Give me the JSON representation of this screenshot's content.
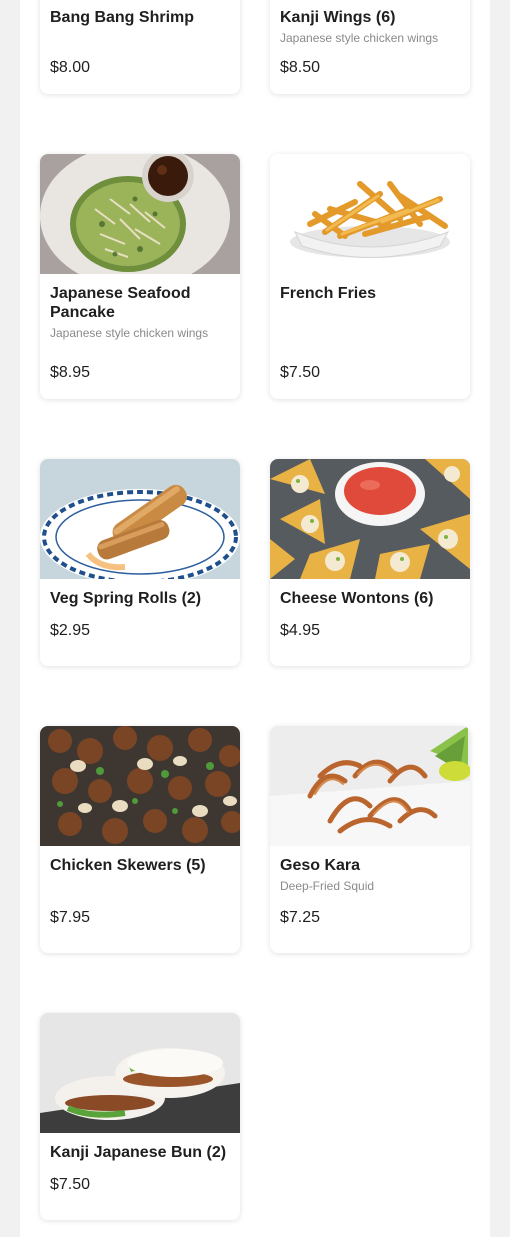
{
  "menu": {
    "items": [
      {
        "name": "Bang Bang Shrimp",
        "description": "",
        "price": "$8.00"
      },
      {
        "name": "Kanji Wings (6)",
        "description": "Japanese style chicken wings",
        "price": "$8.50"
      },
      {
        "name": "Japanese Seafood Pancake",
        "description": "Japanese style chicken wings",
        "price": "$8.95",
        "image": "seafood-pancake-photo"
      },
      {
        "name": "French Fries",
        "description": "",
        "price": "$7.50",
        "image": "french-fries-photo"
      },
      {
        "name": "Veg Spring Rolls (2)",
        "description": "",
        "price": "$2.95",
        "image": "spring-rolls-photo"
      },
      {
        "name": "Cheese Wontons (6)",
        "description": "",
        "price": "$4.95",
        "image": "cheese-wontons-photo"
      },
      {
        "name": "Chicken Skewers (5)",
        "description": "",
        "price": "$7.95",
        "image": "chicken-skewers-photo"
      },
      {
        "name": "Geso Kara",
        "description": "Deep-Fried Squid",
        "price": "$7.25",
        "image": "geso-kara-photo"
      },
      {
        "name": "Kanji Japanese Bun (2)",
        "description": "",
        "price": "$7.50",
        "image": "japanese-bun-photo"
      }
    ]
  }
}
